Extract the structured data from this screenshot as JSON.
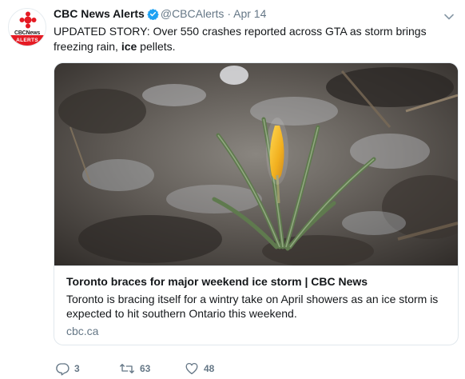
{
  "tweet": {
    "author_name": "CBC News Alerts",
    "handle": "@CBCAlerts",
    "separator": "·",
    "date": "Apr 14",
    "text_before": "UPDATED STORY: Over 550 crashes reported across GTA as storm brings freezing rain, ",
    "text_bold": "ice",
    "text_after": " pellets."
  },
  "avatar": {
    "brand_text": "CBCNews",
    "badge_text": "ALERTS",
    "brand_color": "#e51b24"
  },
  "card": {
    "title": "Toronto braces for major weekend ice storm | CBC News",
    "description": "Toronto is bracing itself for a wintry take on April showers as an ice storm is expected to hit southern Ontario this weekend.",
    "domain": "cbc.ca",
    "image_subject": "yellow crocus bud encased in ice"
  },
  "actions": {
    "reply_count": "3",
    "retweet_count": "63",
    "like_count": "48"
  },
  "colors": {
    "text_primary": "#14171a",
    "text_secondary": "#657786",
    "verified_blue": "#1da1f2",
    "border": "#e1e8ed"
  }
}
